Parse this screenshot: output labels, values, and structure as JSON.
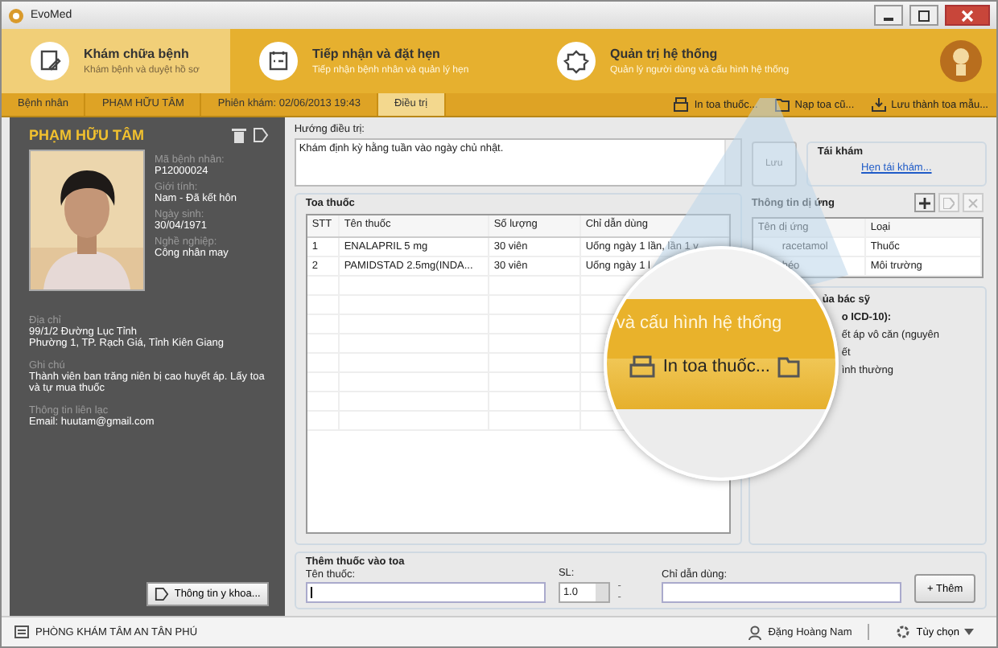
{
  "window": {
    "title": "EvoMed"
  },
  "ribbon_tabs": [
    {
      "title": "Khám chữa bệnh",
      "subtitle": "Khám bệnh và duyệt hồ sơ",
      "selected": true
    },
    {
      "title": "Tiếp nhận và đặt hẹn",
      "subtitle": "Tiếp nhận bệnh nhân và quản lý hẹn",
      "selected": false
    },
    {
      "title": "Quản trị hệ thống",
      "subtitle": "Quản lý người dùng và cấu hình hệ thống",
      "selected": false
    }
  ],
  "breadcrumb": [
    {
      "label": "Bệnh nhân",
      "selected": false
    },
    {
      "label": "PHẠM HỮU TÂM",
      "selected": false
    },
    {
      "label": "Phiên khám: 02/06/2013 19:43",
      "selected": false
    },
    {
      "label": "Điều trị",
      "selected": true
    }
  ],
  "toolbar": [
    {
      "label": "In toa thuốc..."
    },
    {
      "label": "Nạp toa cũ..."
    },
    {
      "label": "Lưu thành toa mẫu..."
    }
  ],
  "patient": {
    "name": "PHẠM HỮU TÂM",
    "fields": [
      {
        "label": "Mã bệnh nhân:",
        "value": "P12000024"
      },
      {
        "label": "Giới tính:",
        "value": "Nam - Đã kết hôn"
      },
      {
        "label": "Ngày sinh:",
        "value": "30/04/1971"
      },
      {
        "label": "Nghề nghiệp:",
        "value": "Công nhân may"
      }
    ],
    "details": [
      {
        "label": "Địa chỉ",
        "lines": [
          "99/1/2 Đường Lục Tỉnh",
          "Phường 1, TP. Rạch Giá, Tỉnh Kiên Giang"
        ]
      },
      {
        "label": "Ghi chú",
        "lines": [
          "Thành viên ban trăng niên bị cao huyết áp. Lấy toa và tự mua thuốc"
        ]
      },
      {
        "label": "Thông tin liên lạc",
        "lines": [
          "Email: huutam@gmail.com"
        ]
      }
    ],
    "medical_button": "Thông tin y khoa..."
  },
  "treatment": {
    "label": "Hướng điều trị:",
    "value": "Khám định kỳ hằng tuần vào ngày chủ nhật."
  },
  "save_button": "Lưu",
  "follow_up": {
    "title": "Tái khám",
    "link": "Hẹn tái khám..."
  },
  "prescription": {
    "title": "Toa thuốc",
    "columns": [
      "STT",
      "Tên thuốc",
      "Số lượng",
      "Chỉ dẫn dùng"
    ],
    "rows": [
      [
        "1",
        "ENALAPRIL 5 mg",
        "30 viên",
        "Uống ngày 1 lần, lần 1 v"
      ],
      [
        "2",
        "PAMIDSTAD 2.5mg(INDA...",
        "30 viên",
        "Uống ngày 1 l"
      ]
    ]
  },
  "allergy": {
    "title": "Thông tin dị ứng",
    "columns": [
      "Tên dị ứng",
      "Loại"
    ],
    "rows": [
      [
        "racetamol",
        "Thuốc"
      ],
      [
        "héo",
        "Môi trường"
      ]
    ]
  },
  "doctor": {
    "title": "ủa bác sỹ",
    "lines": [
      "o ICD-10):",
      "ết áp vô căn (nguyên",
      "ết",
      "ình thường"
    ]
  },
  "add_drug": {
    "title": "Thêm thuốc vào toa",
    "name_label": "Tên thuốc:",
    "qty_label": "SL:",
    "qty": "1.0",
    "unit": "--",
    "instr_label": "Chỉ dẫn dùng:",
    "add_button": "+ Thêm"
  },
  "magnifier": {
    "caption": "và cấu hình hệ thống",
    "button": "In toa thuốc..."
  },
  "status_bar": {
    "clinic": "PHÒNG KHÁM TÂM AN TÂN PHÚ",
    "user": "Đặng Hoàng Nam",
    "options": "Tùy chọn"
  }
}
